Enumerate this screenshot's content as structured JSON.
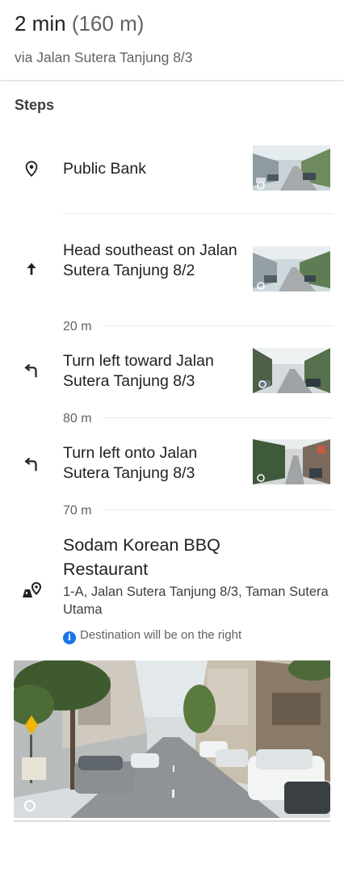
{
  "summary": {
    "time": "2 min",
    "distance": "(160 m)",
    "via": "via Jalan Sutera Tanjung 8/3"
  },
  "steps_heading": "Steps",
  "steps": [
    {
      "icon": "place-pin-icon",
      "text": "Public Bank"
    },
    {
      "icon": "arrow-up-icon",
      "text": "Head southeast on Jalan Sutera Tanjung 8/2",
      "distance": "20 m"
    },
    {
      "icon": "turn-left-icon",
      "text": "Turn left toward Jalan Sutera Tanjung 8/3",
      "distance": "80 m"
    },
    {
      "icon": "turn-left-icon",
      "text": "Turn left onto Jalan Sutera Tanjung 8/3",
      "distance": "70 m"
    }
  ],
  "destination": {
    "icon": "destination-flag-icon",
    "name": "Sodam Korean BBQ Restaurant",
    "address": "1-A, Jalan Sutera Tanjung 8/3, Taman Sutera Utama",
    "note": "Destination will be on the right"
  },
  "colors": {
    "accent": "#1a73e8",
    "text": "#202124",
    "secondary": "#5f6368",
    "divider": "#e8eaed"
  }
}
